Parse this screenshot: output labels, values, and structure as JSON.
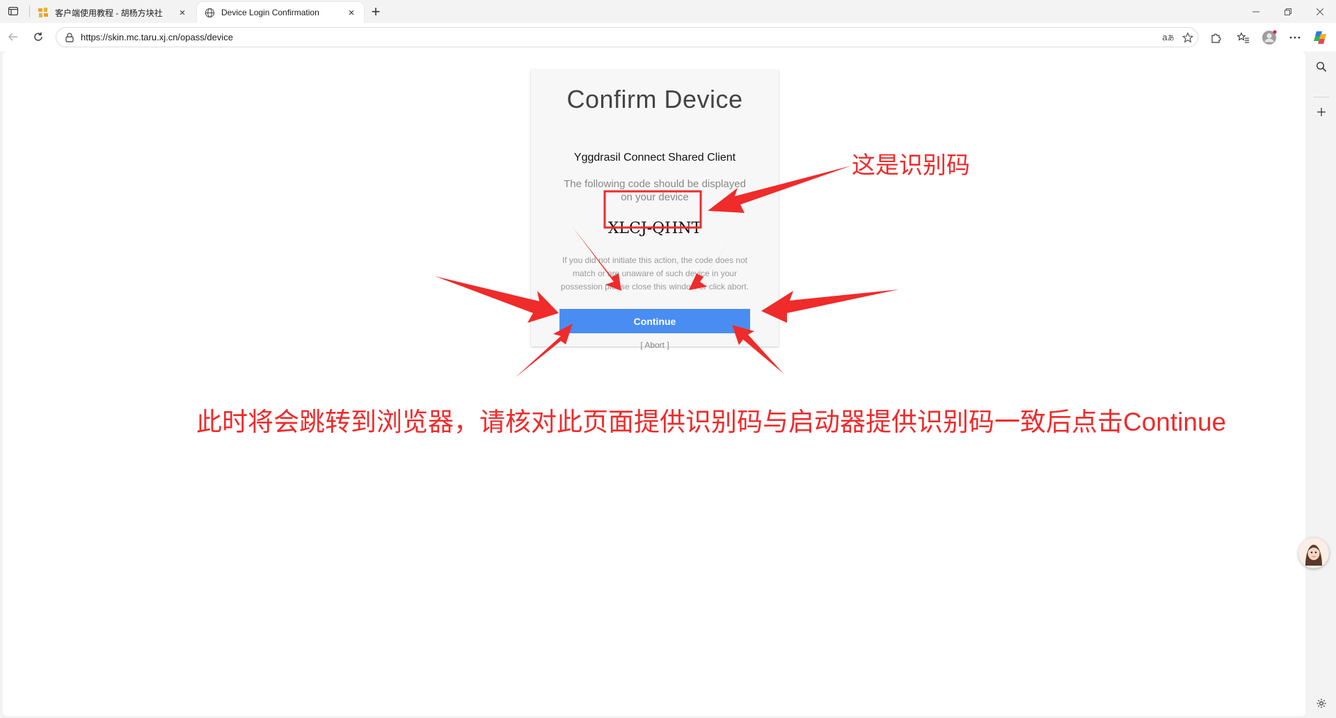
{
  "tabs": [
    {
      "title": "客户端使用教程 - 胡杨方块社",
      "icon": "hu-logo-icon",
      "active": false
    },
    {
      "title": "Device Login Confirmation",
      "icon": "globe-icon",
      "active": true
    }
  ],
  "address_bar": {
    "url": "https://skin.mc.taru.xj.cn/opass/device"
  },
  "card": {
    "title": "Confirm Device",
    "client_name": "Yggdrasil Connect Shared Client",
    "hint": "The following code should be displayed on your device",
    "code": "XLCJ-QHNT",
    "warning": "If you did not initiate this action, the code does not match or are unaware of such device in your possession please close this window or click abort.",
    "continue_label": "Continue",
    "abort_label": "[ Abort ]"
  },
  "annotations": {
    "code_label": "这是识别码",
    "instruction": "此时将会跳转到浏览器，请核对此页面提供识别码与启动器提供识别码一致后点击Continue",
    "color": "#ef2b2b"
  },
  "colors": {
    "accent": "#4a8df2",
    "annotation": "#ef2b2b"
  }
}
